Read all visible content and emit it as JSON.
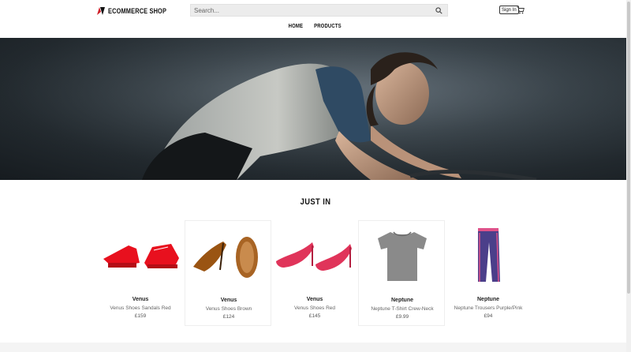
{
  "header": {
    "logo_text": "ECOMMERCE SHOP",
    "search_placeholder": "Search...",
    "signin_label": "Sign In"
  },
  "nav": {
    "items": [
      {
        "label": "HOME"
      },
      {
        "label": "PRODUCTS"
      }
    ]
  },
  "section": {
    "title": "JUST IN"
  },
  "products": [
    {
      "brand": "Venus",
      "name": "Venus Shoes Sandals Red",
      "price": "£159",
      "icon": "red-sandals"
    },
    {
      "brand": "Venus",
      "name": "Venus Shoes Brown",
      "price": "£124",
      "icon": "brown-heels"
    },
    {
      "brand": "Venus",
      "name": "Venus Shoes Red",
      "price": "£145",
      "icon": "red-heels"
    },
    {
      "brand": "Neptune",
      "name": "Neptune T-Shirt Crew-Neck",
      "price": "£9.99",
      "icon": "grey-tshirt"
    },
    {
      "brand": "Neptune",
      "name": "Neptune Trousers Purple/Pink",
      "price": "£94",
      "icon": "purple-trousers"
    }
  ],
  "colors": {
    "logo_red": "#d0202a",
    "text": "#111111",
    "muted": "#666666"
  }
}
